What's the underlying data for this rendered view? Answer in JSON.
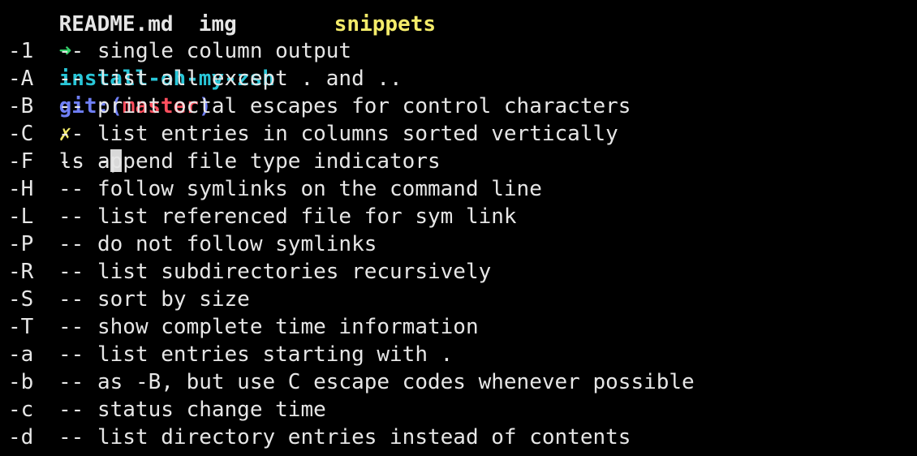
{
  "partial_line": {
    "item_a": "README.md  img",
    "item_b": "snippets"
  },
  "prompt": {
    "arrow": "➜",
    "directory": "install-oh-my-zsh",
    "git_label": "git:",
    "paren_open": "(",
    "branch": "master",
    "paren_close": ")",
    "dirty_mark": "✗",
    "command": "ls -"
  },
  "options": [
    {
      "flag": "-1",
      "sep": "--",
      "desc": "single column output"
    },
    {
      "flag": "-A",
      "sep": "--",
      "desc": "list all except . and .."
    },
    {
      "flag": "-B",
      "sep": "--",
      "desc": "print octal escapes for control characters"
    },
    {
      "flag": "-C",
      "sep": "--",
      "desc": "list entries in columns sorted vertically"
    },
    {
      "flag": "-F",
      "sep": "--",
      "desc": "append file type indicators"
    },
    {
      "flag": "-H",
      "sep": "--",
      "desc": "follow symlinks on the command line"
    },
    {
      "flag": "-L",
      "sep": "--",
      "desc": "list referenced file for sym link"
    },
    {
      "flag": "-P",
      "sep": "--",
      "desc": "do not follow symlinks"
    },
    {
      "flag": "-R",
      "sep": "--",
      "desc": "list subdirectories recursively"
    },
    {
      "flag": "-S",
      "sep": "--",
      "desc": "sort by size"
    },
    {
      "flag": "-T",
      "sep": "--",
      "desc": "show complete time information"
    },
    {
      "flag": "-a",
      "sep": "--",
      "desc": "list entries starting with ."
    },
    {
      "flag": "-b",
      "sep": "--",
      "desc": "as -B, but use C escape codes whenever possible"
    },
    {
      "flag": "-c",
      "sep": "--",
      "desc": "status change time"
    },
    {
      "flag": "-d",
      "sep": "--",
      "desc": "list directory entries instead of contents"
    }
  ],
  "colors": {
    "background": "#000000",
    "text": "#e6e6e6",
    "arrow": "#34d36a",
    "directory": "#29c6d8",
    "git": "#6f7ff7",
    "branch": "#ff4f5e",
    "dirty": "#f4ec6a"
  }
}
